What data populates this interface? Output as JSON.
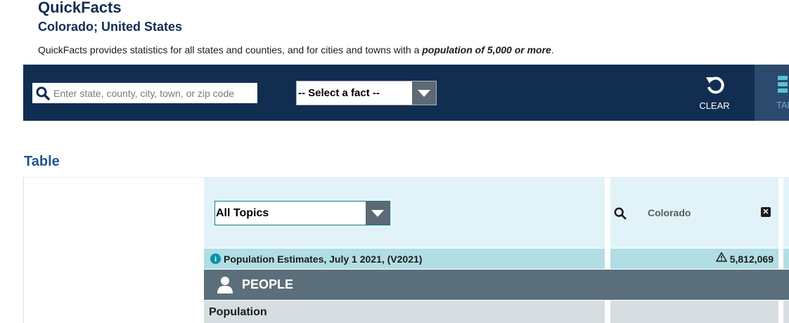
{
  "header": {
    "title": "QuickFacts",
    "subtitle": "Colorado; United States",
    "intro_text": "QuickFacts provides statistics for all states and counties, and for cities and towns with a ",
    "intro_emphasis": "population of 5,000 or more",
    "intro_end": "."
  },
  "toolbar": {
    "search_placeholder": "Enter state, county, city, town, or zip code",
    "fact_select": "-- Select a fact --",
    "clear_label": "CLEAR",
    "table_label": "TABLE"
  },
  "section": {
    "title": "Table"
  },
  "table": {
    "topics_select": "All Topics",
    "column_header": "Colorado",
    "rows": [
      {
        "label": "Population Estimates, July 1 2021, (V2021)",
        "value": "5,812,069"
      }
    ],
    "category": "PEOPLE",
    "subcategory": "Population"
  },
  "colors": {
    "navy": "#112e51",
    "light_blue": "#e1f3f8",
    "row_blue": "#b1dde4",
    "category_gray": "#5b6f7a",
    "subcategory_gray": "#d6dee1"
  }
}
